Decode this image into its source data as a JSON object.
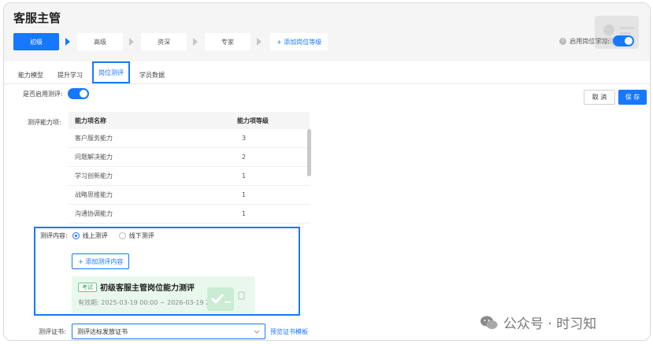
{
  "header": {
    "title": "客服主管",
    "steps": [
      "初级",
      "高级",
      "资深",
      "专家"
    ],
    "add_level_label": "+ 添加岗位等级",
    "enable_post_label": "启用岗位学习:",
    "enable_post_on": true
  },
  "tabs": [
    {
      "label": "能力模型",
      "active": false
    },
    {
      "label": "提升学习",
      "active": false
    },
    {
      "label": "岗位测评",
      "active": true
    },
    {
      "label": "学员数据",
      "active": false
    }
  ],
  "actions": {
    "cancel_label": "取 消",
    "save_label": "保 存"
  },
  "evaluation": {
    "enable_label": "是否启用测评:",
    "enabled": true,
    "ability_label": "测评能力项:",
    "table": {
      "headers": [
        "能力项名称",
        "能力项等级"
      ],
      "rows": [
        [
          "客户服务能力",
          "3"
        ],
        [
          "问题解决能力",
          "2"
        ],
        [
          "学习创新能力",
          "1"
        ],
        [
          "战略思维能力",
          "1"
        ],
        [
          "沟通协调能力",
          "1"
        ]
      ]
    },
    "content_label": "测评内容:",
    "options": [
      {
        "label": "线上测评",
        "selected": true
      },
      {
        "label": "线下测评",
        "selected": false
      }
    ],
    "add_content_label": "+ 添加测评内容",
    "exam": {
      "tag": "考试",
      "title": "初级客服主管岗位能力测评",
      "validity": "有效期: 2025-03-19 00:00 ~ 2026-03-19 23:59"
    },
    "cert_label": "测评证书:",
    "cert_value": "测评达标发放证书",
    "cert_preview_link": "预览证书模板"
  },
  "watermark": {
    "text": "公众号 · 时习知"
  },
  "colors": {
    "primary": "#1677ff",
    "exam_bg": "#e9f8ec",
    "header_bg": "#f5f5f5"
  }
}
